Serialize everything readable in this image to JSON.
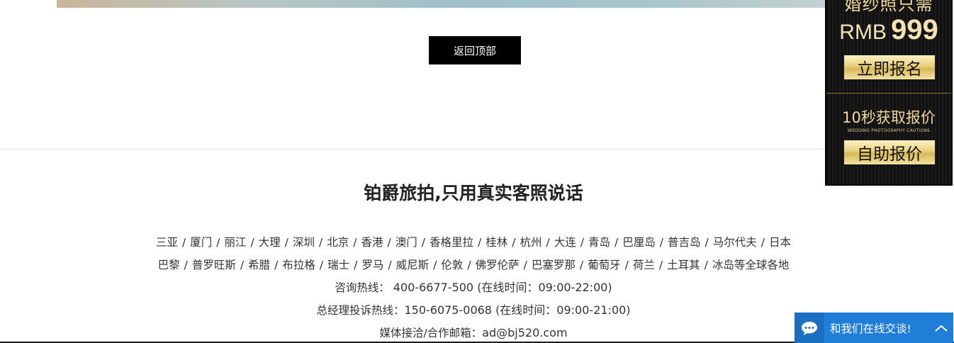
{
  "back_to_top": {
    "label": "返回顶部"
  },
  "slogan": "铂爵旅拍,只用真实客照说话",
  "destinations": {
    "line1": [
      "三亚",
      "厦门",
      "丽江",
      "大理",
      "深圳",
      "北京",
      "香港",
      "澳门",
      "香格里拉",
      "桂林",
      "杭州",
      "大连",
      "青岛",
      "巴厘岛",
      "普吉岛",
      "马尔代夫",
      "日本"
    ],
    "line2": [
      "巴黎",
      "普罗旺斯",
      "希腊",
      "布拉格",
      "瑞士",
      "罗马",
      "威尼斯",
      "伦敦",
      "佛罗伦萨",
      "巴塞罗那",
      "葡萄牙",
      "荷兰",
      "土耳其",
      "冰岛等全球各地"
    ],
    "separator": "/"
  },
  "contact": {
    "hotline_label": "咨询热线：",
    "hotline_value": "400-6677-500 (在线时间：09:00-22:00)",
    "complaint_label": "总经理投诉热线：",
    "complaint_value": "150-6075-0068 (在线时间：09:00-21:00)",
    "media_label": "媒体接洽/合作邮箱：",
    "media_value": "ad@bj520.com"
  },
  "promo": {
    "head": "婚纱照只需",
    "price_currency": "RMB",
    "price_value": "999",
    "signup_label": "立即报名",
    "quote_title": "10秒获取报价",
    "quote_subtitle": "WEDDING PHOTOGRAPHY CAUTIONS",
    "quote_button": "自助报价",
    "colors": {
      "gold": "#f0d99a",
      "panel": "#111111"
    }
  },
  "chat": {
    "label": "和我们在线交谈!",
    "icon": "chat-bubble-icon",
    "chevron_icon": "chevron-up-icon",
    "color": "#1f7ed8"
  }
}
